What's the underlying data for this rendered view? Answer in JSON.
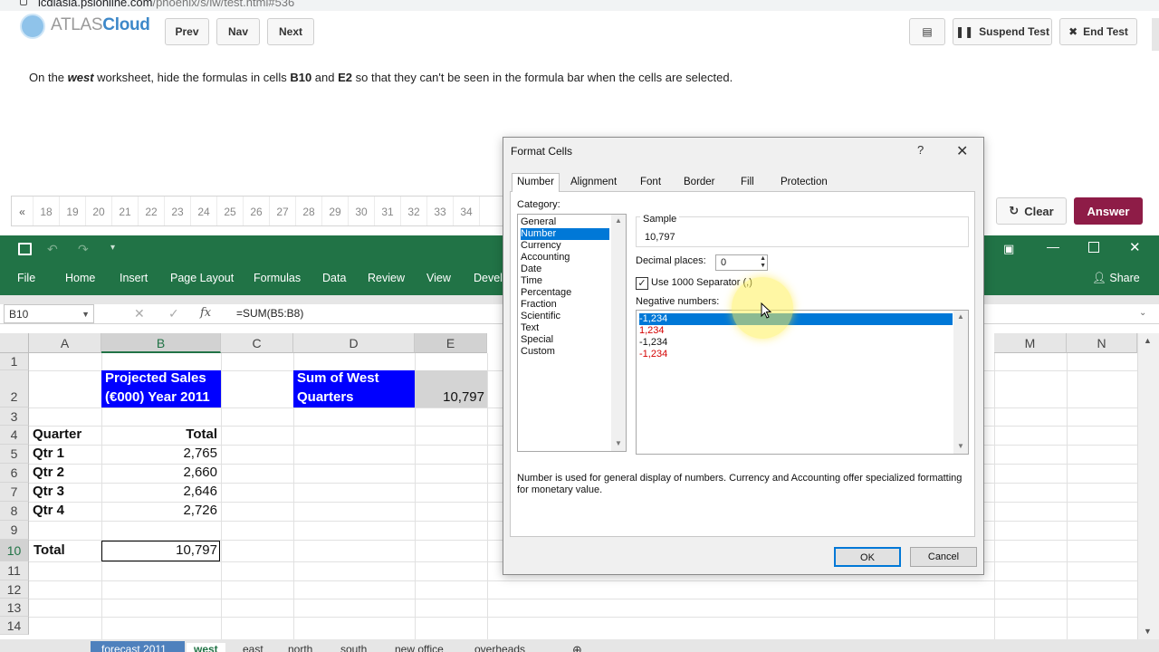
{
  "browser": {
    "url_host": "icdlasia.psionline.com",
    "url_path": "/phoenix/s/lw/test.html#536"
  },
  "atlas": {
    "logo_part1": "ATLAS",
    "logo_part2": "Cloud",
    "prev": "Prev",
    "nav": "Nav",
    "next": "Next",
    "suspend": "Suspend Test",
    "end": "End Test",
    "question_pre": "On the ",
    "question_sheet": "west",
    "question_mid1": " worksheet, hide the formulas in cells ",
    "question_cell1": "B10",
    "question_mid2": " and ",
    "question_cell2": "E2",
    "question_post": " so that they can't be seen in the formula bar when the cells are selected.",
    "question_nav": [
      "«",
      "18",
      "19",
      "20",
      "21",
      "22",
      "23",
      "24",
      "25",
      "26",
      "27",
      "28",
      "29",
      "30",
      "31",
      "32",
      "33",
      "34"
    ],
    "clear": "Clear",
    "answer": "Answer"
  },
  "excel": {
    "ribbon_tabs": [
      "File",
      "Home",
      "Insert",
      "Page Layout",
      "Formulas",
      "Data",
      "Review",
      "View",
      "Develo"
    ],
    "share": "Share",
    "name_box": "B10",
    "fx": "fx",
    "formula": "=SUM(B5:B8)",
    "columns": [
      "A",
      "B",
      "C",
      "D",
      "E",
      "M",
      "N"
    ],
    "rows": [
      "1",
      "2",
      "3",
      "4",
      "5",
      "6",
      "7",
      "8",
      "9",
      "10",
      "11",
      "12",
      "13",
      "14"
    ],
    "cells": {
      "b2_line1": "Projected Sales",
      "b2_line2": "(€000) Year 2011",
      "d2_line1": "Sum of West",
      "d2_line2": "Quarters",
      "e2": "10,797",
      "a4": "Quarter",
      "b4": "Total",
      "a5": "Qtr 1",
      "b5": "2,765",
      "a6": "Qtr 2",
      "b6": "2,660",
      "a7": "Qtr 3",
      "b7": "2,646",
      "a8": "Qtr 4",
      "b8": "2,726",
      "a10": "Total",
      "b10": "10,797"
    },
    "sheet_tabs": [
      "forecast 2011",
      "west",
      "east",
      "north",
      "south",
      "new office",
      "overheads"
    ]
  },
  "dialog": {
    "title": "Format Cells",
    "help": "?",
    "close": "✕",
    "tabs": [
      "Number",
      "Alignment",
      "Font",
      "Border",
      "Fill",
      "Protection"
    ],
    "category_label": "Category:",
    "categories": [
      "General",
      "Number",
      "Currency",
      "Accounting",
      "Date",
      "Time",
      "Percentage",
      "Fraction",
      "Scientific",
      "Text",
      "Special",
      "Custom"
    ],
    "sample_label": "Sample",
    "sample_value": "10,797",
    "decimal_label": "Decimal places:",
    "decimal_value": "0",
    "separator_label": "Use 1000 Separator (,)",
    "separator_checked": true,
    "negative_label": "Negative numbers:",
    "negative_options": [
      "-1,234",
      "1,234",
      "-1,234",
      "-1,234"
    ],
    "description": "Number is used for general display of numbers.  Currency and Accounting offer specialized formatting for monetary value.",
    "ok": "OK",
    "cancel": "Cancel"
  },
  "colors": {
    "excel_green": "#217346",
    "answer_bg": "#8e1c47",
    "highlight_blue": "#0000ff",
    "select_blue": "#0078d7"
  }
}
